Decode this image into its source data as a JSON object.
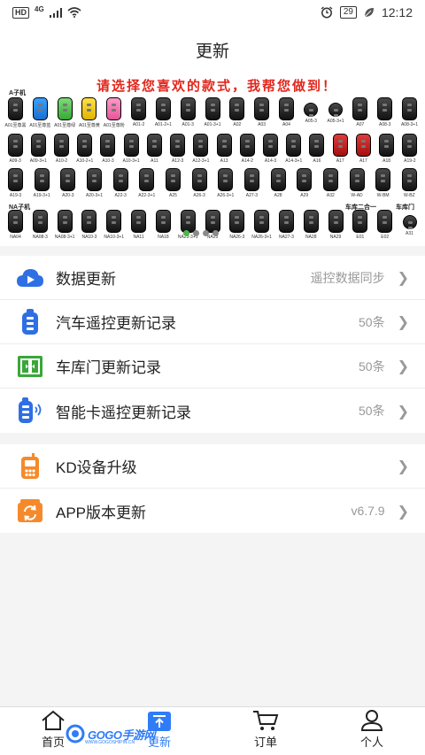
{
  "status_bar": {
    "hd": "HD",
    "network": "4G",
    "battery": "29",
    "time": "12:12"
  },
  "header": {
    "title": "更新"
  },
  "banner": {
    "headline": "请选择您喜欢的款式，我帮您做到！",
    "section_a": "A子机",
    "section_na": "NA子机",
    "section_garage_combo": "车库二合一",
    "section_garage": "车库门",
    "rows": [
      [
        {
          "label": "A01至尊黑",
          "color": "dark"
        },
        {
          "label": "A01至尊蓝",
          "color": "blue"
        },
        {
          "label": "A01至尊绿",
          "color": "green"
        },
        {
          "label": "A01至尊黄",
          "color": "yellow"
        },
        {
          "label": "A01至尊粉",
          "color": "pink"
        },
        {
          "label": "A01-2",
          "color": "dark"
        },
        {
          "label": "A01-2+1",
          "color": "dark"
        },
        {
          "label": "A01-3",
          "color": "dark"
        },
        {
          "label": "A01-3+1",
          "color": "dark"
        },
        {
          "label": "A02",
          "color": "dark"
        },
        {
          "label": "A03",
          "color": "dark"
        },
        {
          "label": "A04",
          "color": "dark"
        },
        {
          "label": "A05-3",
          "color": "round"
        },
        {
          "label": "A05-3+1",
          "color": "round"
        },
        {
          "label": "A07",
          "color": "dark"
        },
        {
          "label": "A08-3",
          "color": "dark"
        },
        {
          "label": "A08-3+1",
          "color": "dark"
        }
      ],
      [
        {
          "label": "A09-3",
          "color": "dark"
        },
        {
          "label": "A09-3+1",
          "color": "dark"
        },
        {
          "label": "A10-2",
          "color": "dark"
        },
        {
          "label": "A10-2+1",
          "color": "dark"
        },
        {
          "label": "A10-3",
          "color": "dark"
        },
        {
          "label": "A10-3+1",
          "color": "dark"
        },
        {
          "label": "A11",
          "color": "dark"
        },
        {
          "label": "A12-3",
          "color": "dark"
        },
        {
          "label": "A12-3+1",
          "color": "dark"
        },
        {
          "label": "A13",
          "color": "dark"
        },
        {
          "label": "A14-2",
          "color": "dark"
        },
        {
          "label": "A14-3",
          "color": "dark"
        },
        {
          "label": "A14-3+1",
          "color": "dark"
        },
        {
          "label": "A16",
          "color": "dark"
        },
        {
          "label": "A17",
          "color": "red"
        },
        {
          "label": "A17",
          "color": "red"
        },
        {
          "label": "A18",
          "color": "dark"
        },
        {
          "label": "A19-2",
          "color": "dark"
        }
      ],
      [
        {
          "label": "A19-3",
          "color": "dark"
        },
        {
          "label": "A19-3+1",
          "color": "dark"
        },
        {
          "label": "A20-3",
          "color": "dark"
        },
        {
          "label": "A20-3+1",
          "color": "dark"
        },
        {
          "label": "A22-3",
          "color": "dark"
        },
        {
          "label": "A22-3+1",
          "color": "dark"
        },
        {
          "label": "A25",
          "color": "dark"
        },
        {
          "label": "A26-3",
          "color": "dark"
        },
        {
          "label": "A26-3+1",
          "color": "dark"
        },
        {
          "label": "A27-3",
          "color": "dark"
        },
        {
          "label": "A28",
          "color": "dark"
        },
        {
          "label": "A29",
          "color": "dark"
        },
        {
          "label": "A32",
          "color": "dark"
        },
        {
          "label": "W-AD",
          "color": "dark"
        },
        {
          "label": "W-BM",
          "color": "dark"
        },
        {
          "label": "W-BZ",
          "color": "dark"
        }
      ],
      [
        {
          "label": "NA04",
          "color": "dark"
        },
        {
          "label": "NA08-3",
          "color": "dark"
        },
        {
          "label": "NA08-3+1",
          "color": "dark"
        },
        {
          "label": "NA10-3",
          "color": "dark"
        },
        {
          "label": "NA10-3+1",
          "color": "dark"
        },
        {
          "label": "NA11",
          "color": "dark"
        },
        {
          "label": "NA18",
          "color": "dark"
        },
        {
          "label": "NA23-3+1",
          "color": "dark"
        },
        {
          "label": "NA25",
          "color": "dark"
        },
        {
          "label": "NA26-3",
          "color": "dark"
        },
        {
          "label": "NA26-3+1",
          "color": "dark"
        },
        {
          "label": "NA27-3",
          "color": "dark"
        },
        {
          "label": "NA28",
          "color": "dark"
        },
        {
          "label": "NA29",
          "color": "dark"
        },
        {
          "label": "E01",
          "color": "dark"
        },
        {
          "label": "E02",
          "color": "dark"
        },
        {
          "label": "A31",
          "color": "round"
        }
      ]
    ]
  },
  "menu_group_1": [
    {
      "label": "数据更新",
      "value": "遥控数据同步",
      "icon": "cloud-play-icon"
    },
    {
      "label": "汽车遥控更新记录",
      "value": "50条",
      "icon": "car-remote-icon"
    },
    {
      "label": "车库门更新记录",
      "value": "50条",
      "icon": "garage-door-icon"
    },
    {
      "label": "智能卡遥控更新记录",
      "value": "50条",
      "icon": "smart-card-remote-icon"
    }
  ],
  "menu_group_2": [
    {
      "label": "KD设备升级",
      "value": "",
      "icon": "kd-device-icon"
    },
    {
      "label": "APP版本更新",
      "value": "v6.7.9",
      "icon": "app-update-icon"
    }
  ],
  "tab_bar": {
    "home": "首页",
    "update": "更新",
    "orders": "订单",
    "profile": "个人"
  },
  "watermark": {
    "text": "GOGO手游网",
    "sub": "WWW.GOGOSHIPIN.CN"
  },
  "colors": {
    "accent": "#2f7cf6",
    "headline_red": "#e3261c",
    "cloud_blue": "#2f6fe4",
    "orange": "#f58a2c",
    "green": "#3aa63a"
  }
}
